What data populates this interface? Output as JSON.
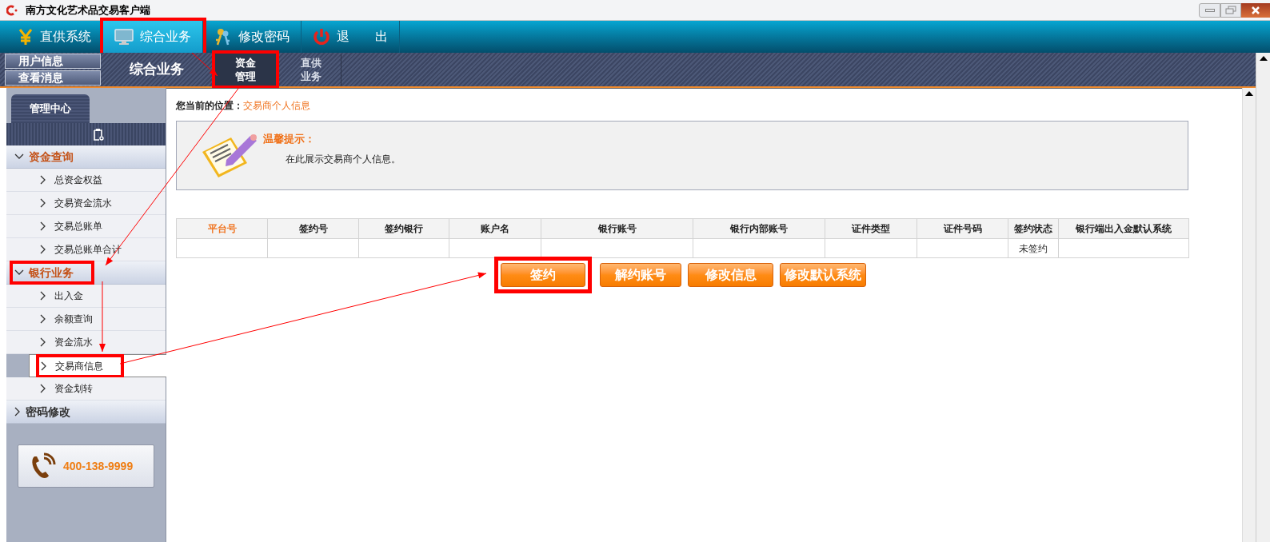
{
  "window": {
    "title": "南方文化艺术品交易客户端"
  },
  "nav": [
    {
      "label": "直供系统",
      "kind": "yen",
      "selected": false,
      "highlighted": false
    },
    {
      "label": "综合业务",
      "kind": "monitor",
      "selected": true,
      "highlighted": true
    },
    {
      "label": "修改密码",
      "kind": "keys",
      "selected": false,
      "highlighted": false
    },
    {
      "label": "退 出",
      "kind": "power",
      "selected": false,
      "highlighted": false
    }
  ],
  "subbar": {
    "buttons": [
      "用户信息",
      "查看消息"
    ],
    "title": "综合业务",
    "tabs": [
      {
        "lines": [
          "资金",
          "管理"
        ],
        "selected": true,
        "highlighted": true
      },
      {
        "lines": [
          "直供",
          "业务"
        ],
        "selected": false,
        "highlighted": false
      }
    ]
  },
  "sidebar": {
    "tab": "管理中心",
    "sections": [
      {
        "label": "资金查询",
        "expanded": true,
        "highlighted": false,
        "children": [
          {
            "label": "总资金权益",
            "selected": false,
            "highlighted": false
          },
          {
            "label": "交易资金流水",
            "selected": false,
            "highlighted": false
          },
          {
            "label": "交易总账单",
            "selected": false,
            "highlighted": false
          },
          {
            "label": "交易总账单合计",
            "selected": false,
            "highlighted": false
          }
        ]
      },
      {
        "label": "银行业务",
        "expanded": true,
        "highlighted": true,
        "children": [
          {
            "label": "出入金",
            "selected": false,
            "highlighted": false
          },
          {
            "label": "余额查询",
            "selected": false,
            "highlighted": false
          },
          {
            "label": "资金流水",
            "selected": false,
            "highlighted": false
          },
          {
            "label": "交易商信息",
            "selected": true,
            "highlighted": true
          },
          {
            "label": "资金划转",
            "selected": false,
            "highlighted": false
          }
        ]
      },
      {
        "label": "密码修改",
        "expanded": false,
        "highlighted": false
      }
    ],
    "phone": "400-138-9999"
  },
  "content": {
    "breadcrumb": {
      "label": "您当前的位置：",
      "current": "交易商个人信息"
    },
    "tip": {
      "title": "温馨提示：",
      "text": "在此展示交易商个人信息。"
    },
    "table": {
      "columns": [
        {
          "label": "平台号",
          "selected": true
        },
        {
          "label": "签约号",
          "selected": false
        },
        {
          "label": "签约银行",
          "selected": false
        },
        {
          "label": "账户名",
          "selected": false
        },
        {
          "label": "银行账号",
          "selected": false
        },
        {
          "label": "银行内部账号",
          "selected": false
        },
        {
          "label": "证件类型",
          "selected": false
        },
        {
          "label": "证件号码",
          "selected": false
        },
        {
          "label": "签约状态",
          "selected": false
        },
        {
          "label": "银行端出入金默认系统",
          "selected": false
        }
      ],
      "rows": [
        {
          "cells": [
            null,
            null,
            null,
            null,
            null,
            null,
            null,
            null,
            "未签约",
            null
          ]
        }
      ]
    },
    "buttons": [
      {
        "label": "签约",
        "highlighted": true
      },
      {
        "label": "解约账号",
        "highlighted": false
      },
      {
        "label": "修改信息",
        "highlighted": false
      },
      {
        "label": "修改默认系统",
        "highlighted": false
      }
    ]
  }
}
